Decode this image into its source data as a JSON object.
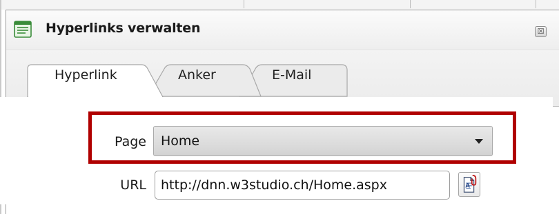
{
  "dialog": {
    "title": "Hyperlinks verwalten",
    "title_icon": "dialog-list-icon",
    "close_icon": "close-icon",
    "close_glyph": "☒"
  },
  "tabs": [
    {
      "label": "Hyperlink",
      "active": true
    },
    {
      "label": "Anker",
      "active": false
    },
    {
      "label": "E-Mail",
      "active": false
    }
  ],
  "form": {
    "page": {
      "label": "Page",
      "value": "Home"
    },
    "url": {
      "label": "URL",
      "value": "http://dnn.w3studio.ch/Home.aspx",
      "browse_icon": "document-link-icon"
    }
  },
  "colors": {
    "highlight": "#b00000",
    "icon_green": "#3a8c3a"
  }
}
